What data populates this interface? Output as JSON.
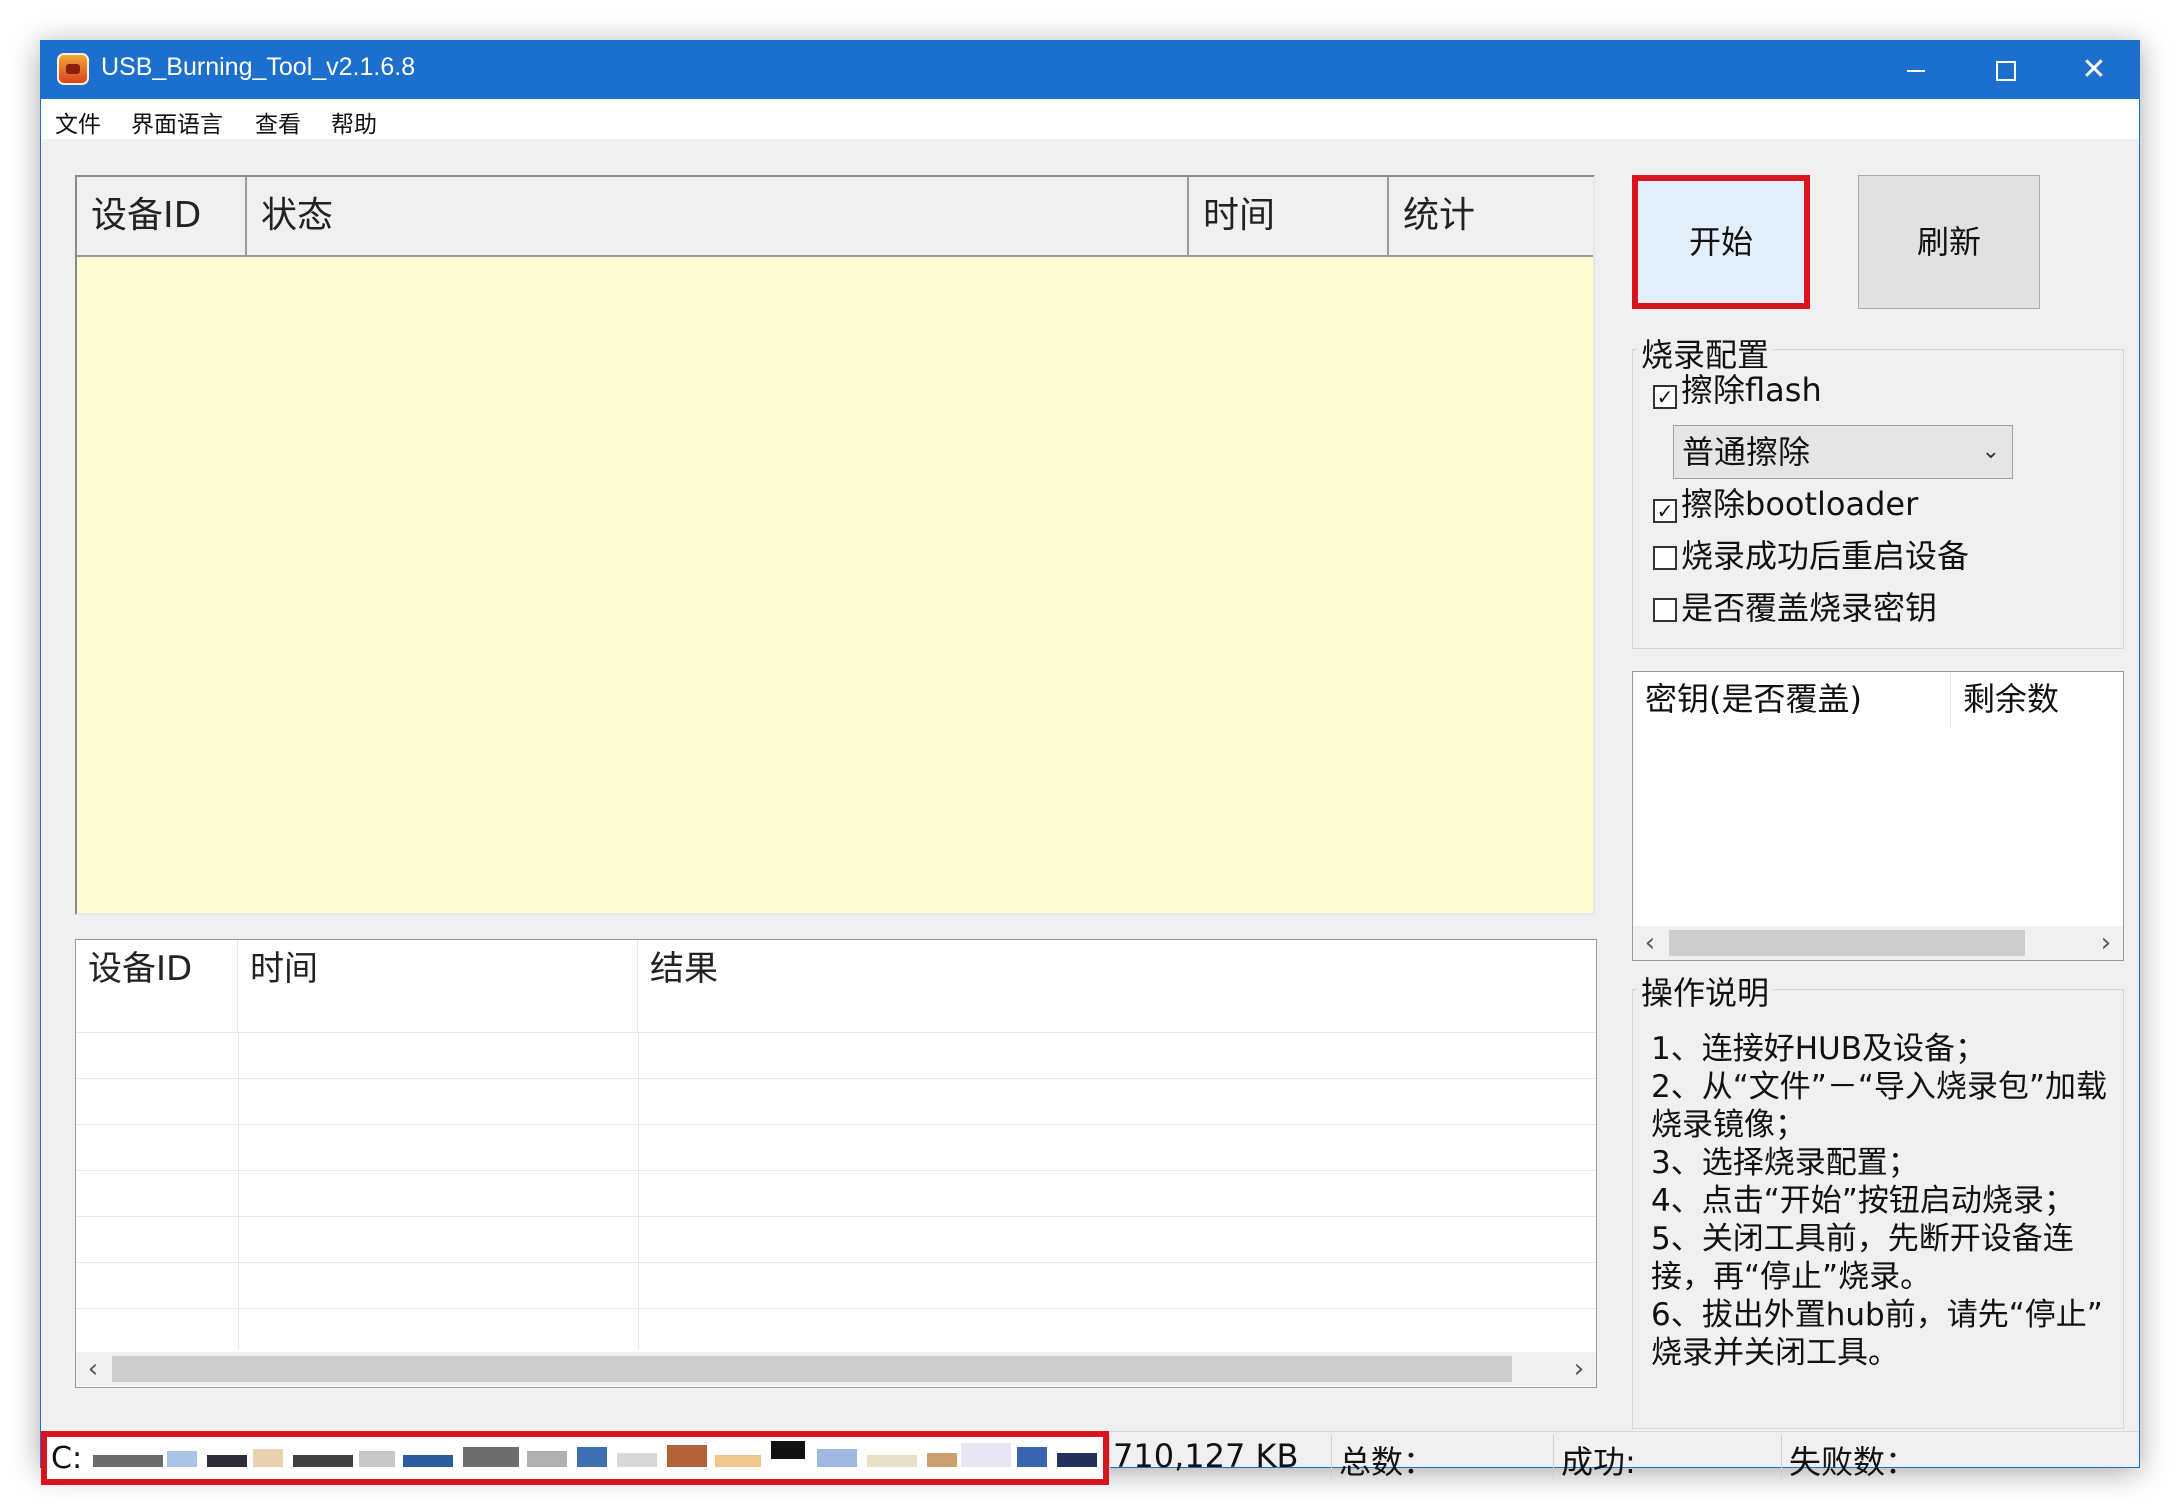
{
  "window": {
    "title": "USB_Burning_Tool_v2.1.6.8",
    "controls": {
      "minimize": "minimize",
      "maximize": "maximize",
      "close": "✕"
    }
  },
  "menu": {
    "items": [
      {
        "label": "文件"
      },
      {
        "label": "界面语言"
      },
      {
        "label": "查看"
      },
      {
        "label": "帮助"
      }
    ]
  },
  "device_list": {
    "columns": [
      "设备ID",
      "状态",
      "时间",
      "统计"
    ],
    "background": "#fdfdd3",
    "rows": []
  },
  "result_list": {
    "columns": [
      "设备ID",
      "时间",
      "结果"
    ],
    "rows": []
  },
  "buttons": {
    "start": "开始",
    "refresh": "刷新"
  },
  "burn_config": {
    "title": "烧录配置",
    "erase_flash": {
      "label": "擦除flash",
      "checked": true
    },
    "erase_mode": {
      "selected": "普通擦除"
    },
    "erase_bootloader": {
      "label": "擦除bootloader",
      "checked": true
    },
    "reboot_after_success": {
      "label": "烧录成功后重启设备",
      "checked": false
    },
    "overwrite_key": {
      "label": "是否覆盖烧录密钥",
      "checked": false
    }
  },
  "key_list": {
    "columns": [
      "密钥(是否覆盖)",
      "剩余数"
    ]
  },
  "instructions": {
    "title": "操作说明",
    "lines": [
      "1、连接好HUB及设备；",
      "2、从“文件”－“导入烧录包”加载",
      "烧录镜像；",
      "3、选择烧录配置；",
      "4、点击“开始”按钮启动烧录；",
      "5、关闭工具前，先断开设备连",
      "接，再“停止”烧录。",
      "6、拔出外置hub前，请先“停止”",
      "烧录并关闭工具。"
    ]
  },
  "status_bar": {
    "path_prefix": "C:",
    "size": "710,127 KB",
    "total": "总数：",
    "success": "成功:",
    "fail": "失败数："
  },
  "colors": {
    "titlebar": "#1d6fce",
    "highlight_border": "#d8141e",
    "start_button_bg": "#e3eefb"
  }
}
